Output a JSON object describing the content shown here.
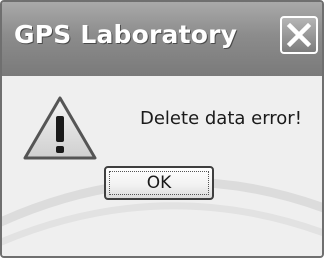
{
  "window": {
    "title": "GPS Laboratory",
    "close_icon": "close-icon"
  },
  "message": {
    "text": "Delete data error!",
    "icon": "warning-icon"
  },
  "buttons": {
    "ok_label": "OK"
  },
  "colors": {
    "titlebar": "#8c8c8c",
    "body": "#efefef",
    "text": "#1a1a1a"
  }
}
